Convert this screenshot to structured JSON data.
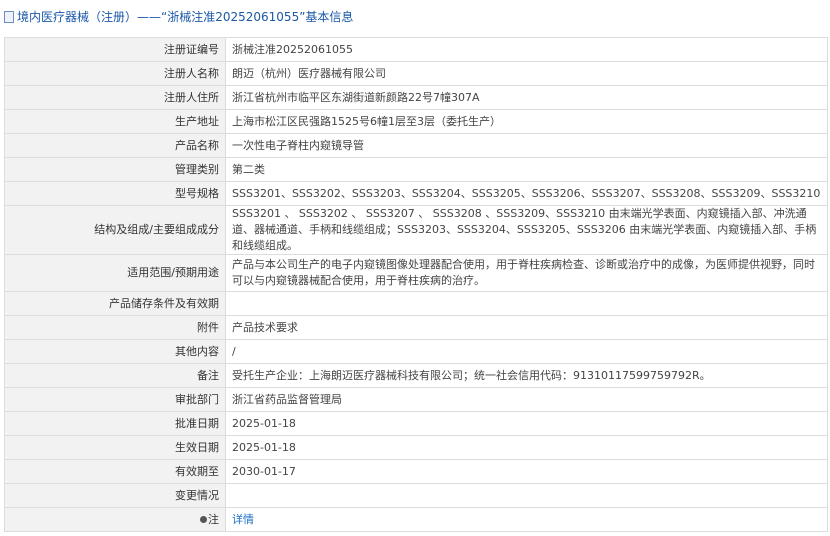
{
  "header": {
    "title": "境内医疗器械（注册）——“浙械注准20252061055”基本信息"
  },
  "rows": [
    {
      "label": "注册证编号",
      "value": "浙械注准20252061055"
    },
    {
      "label": "注册人名称",
      "value": "朗迈（杭州）医疗器械有限公司"
    },
    {
      "label": "注册人住所",
      "value": "浙江省杭州市临平区东湖街道新颜路22号7幢307A"
    },
    {
      "label": "生产地址",
      "value": "上海市松江区民强路1525号6幢1层至3层（委托生产）"
    },
    {
      "label": "产品名称",
      "value": "一次性电子脊柱内窥镜导管"
    },
    {
      "label": "管理类别",
      "value": "第二类"
    },
    {
      "label": "型号规格",
      "value": "SSS3201、SSS3202、SSS3203、SSS3204、SSS3205、SSS3206、SSS3207、SSS3208、SSS3209、SSS3210"
    },
    {
      "label": "结构及组成/主要组成成分",
      "value": "SSS3201 、 SSS3202 、 SSS3207 、 SSS3208 、SSS3209、SSS3210 由末端光学表面、内窥镜插入部、冲洗通道、器械通道、手柄和线缆组成；SSS3203、SSS3204、SSS3205、SSS3206 由末端光学表面、内窥镜插入部、手柄和线缆组成。"
    },
    {
      "label": "适用范围/预期用途",
      "value": "产品与本公司生产的电子内窥镜图像处理器配合使用，用于脊柱疾病检查、诊断或治疗中的成像，为医师提供视野，同时可以与内窥镜器械配合使用，用于脊柱疾病的治疗。"
    },
    {
      "label": "产品储存条件及有效期",
      "value": ""
    },
    {
      "label": "附件",
      "value": "产品技术要求"
    },
    {
      "label": "其他内容",
      "value": "/"
    },
    {
      "label": "备注",
      "value": "受托生产企业：上海朗迈医疗器械科技有限公司；统一社会信用代码：91310117599759792R。"
    },
    {
      "label": "审批部门",
      "value": "浙江省药品监督管理局"
    },
    {
      "label": "批准日期",
      "value": "2025-01-18"
    },
    {
      "label": "生效日期",
      "value": "2025-01-18"
    },
    {
      "label": "有效期至",
      "value": "2030-01-17"
    },
    {
      "label": "变更情况",
      "value": ""
    },
    {
      "label": "注",
      "value": "详情"
    }
  ]
}
